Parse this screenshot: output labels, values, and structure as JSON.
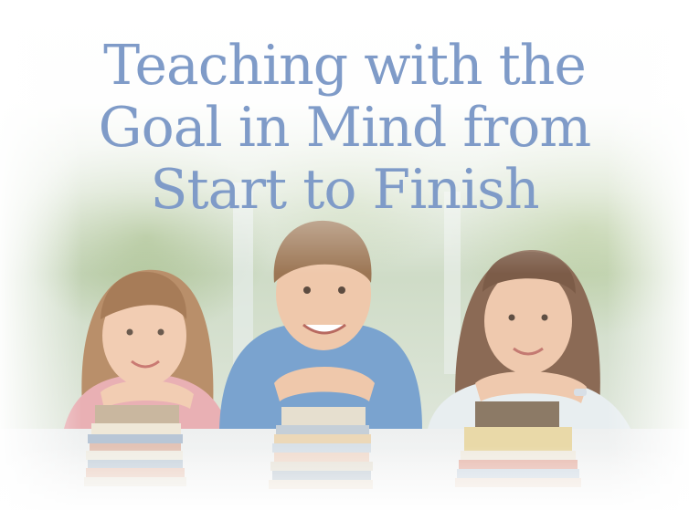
{
  "headline": {
    "line1": "Teaching with the",
    "line2": "Goal in Mind from",
    "line3": "Start to Finish"
  },
  "colors": {
    "headline": "#7f9bc8",
    "background": "#ffffff"
  }
}
